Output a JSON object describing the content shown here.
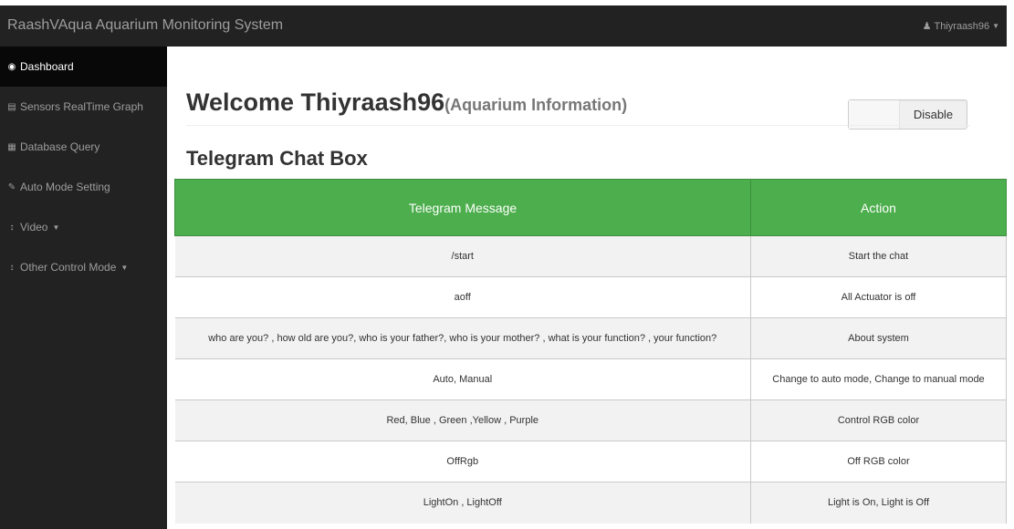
{
  "navbar": {
    "brand": "RaashVAqua Aquarium Monitoring System",
    "user": "Thiyraash96"
  },
  "sidebar": {
    "items": [
      {
        "label": "Dashboard",
        "icon": "dashboard-icon"
      },
      {
        "label": "Sensors RealTime Graph",
        "icon": "bar-chart-icon"
      },
      {
        "label": "Database Query",
        "icon": "table-icon"
      },
      {
        "label": "Auto Mode Setting",
        "icon": "edit-icon"
      },
      {
        "label": "Video",
        "icon": "sort-icon"
      },
      {
        "label": "Other Control Mode",
        "icon": "sort-icon"
      }
    ]
  },
  "main": {
    "welcome": "Welcome Thiyraash96",
    "welcome_sub": "(Aquarium Information)",
    "toggle_label": "Disable",
    "section_title": "Telegram Chat Box",
    "table": {
      "headers": [
        "Telegram Message",
        "Action"
      ],
      "rows": [
        [
          "/start",
          "Start the chat"
        ],
        [
          "aoff",
          "All Actuator is off"
        ],
        [
          "who are you? , how old are you?, who is your father?, who is your mother? , what is your function? , your function?",
          "About system"
        ],
        [
          "Auto, Manual",
          "Change to auto mode, Change to manual mode"
        ],
        [
          "Red, Blue , Green ,Yellow , Purple",
          "Control RGB color"
        ],
        [
          "OffRgb",
          "Off RGB color"
        ],
        [
          "LightOn , LightOff",
          "Light is On, Light is Off"
        ]
      ]
    }
  },
  "colors": {
    "navbar_bg": "#222222",
    "sidebar_active_bg": "#080808",
    "table_header_bg": "#4cae4c"
  }
}
